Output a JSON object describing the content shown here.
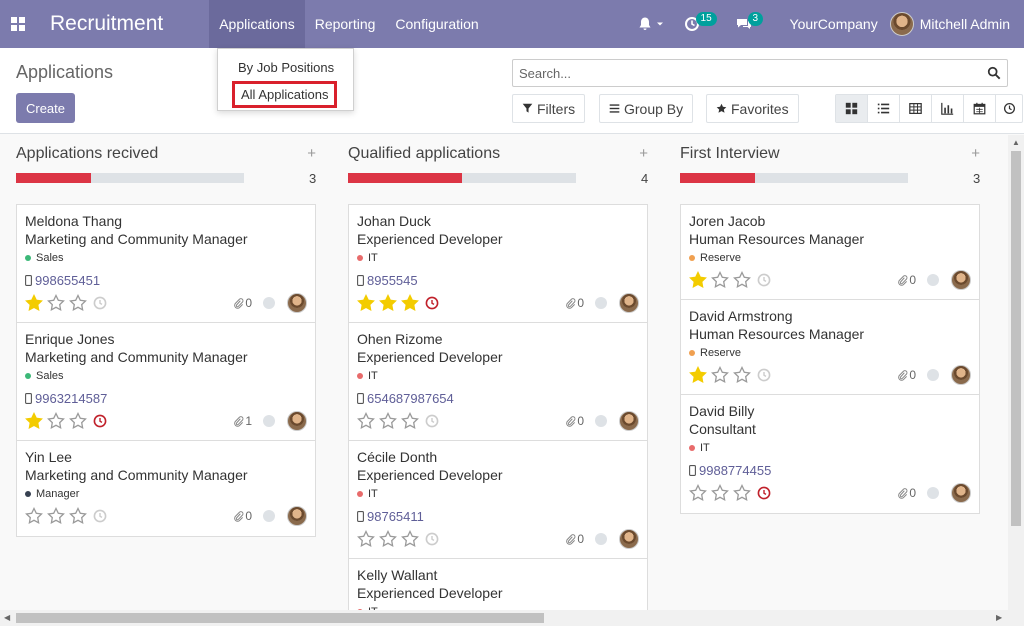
{
  "navbar": {
    "app_name": "Recruitment",
    "menu": [
      "Applications",
      "Reporting",
      "Configuration"
    ],
    "activity_count": "15",
    "message_count": "3",
    "company": "YourCompany",
    "user": "Mitchell Admin"
  },
  "dropdown": {
    "items": [
      "By Job Positions",
      "All Applications"
    ]
  },
  "control": {
    "breadcrumb": "Applications",
    "create_label": "Create",
    "search_placeholder": "Search...",
    "filters_label": "Filters",
    "group_by_label": "Group By",
    "favorites_label": "Favorites",
    "views": [
      "kanban-icon",
      "list-icon",
      "pivot-icon",
      "graph-icon",
      "calendar-icon",
      "activity-icon"
    ]
  },
  "columns": [
    {
      "title": "Applications recived",
      "count": "3",
      "progress": 0.33,
      "cards": [
        {
          "name": "Meldona Thang",
          "job": "Marketing and Community Manager",
          "tag": "Sales",
          "tag_color": "#3cb878",
          "phone": "998655451",
          "stars": 1,
          "activity": "none",
          "attachments": "0"
        },
        {
          "name": "Enrique Jones",
          "job": "Marketing and Community Manager",
          "tag": "Sales",
          "tag_color": "#3cb878",
          "phone": "9963214587",
          "stars": 1,
          "activity": "overdue",
          "attachments": "1"
        },
        {
          "name": "Yin Lee",
          "job": "Marketing and Community Manager",
          "tag": "Manager",
          "tag_color": "#374151",
          "phone": "",
          "stars": 0,
          "activity": "none",
          "attachments": "0"
        }
      ]
    },
    {
      "title": "Qualified applications",
      "count": "4",
      "progress": 0.5,
      "cards": [
        {
          "name": "Johan Duck",
          "job": "Experienced Developer",
          "tag": "IT",
          "tag_color": "#e86b6b",
          "phone": "8955545",
          "stars": 3,
          "activity": "overdue",
          "attachments": "0"
        },
        {
          "name": "Ohen Rizome",
          "job": "Experienced Developer",
          "tag": "IT",
          "tag_color": "#e86b6b",
          "phone": "654687987654",
          "stars": 0,
          "activity": "none",
          "attachments": "0"
        },
        {
          "name": "Cécile Donth",
          "job": "Experienced Developer",
          "tag": "IT",
          "tag_color": "#e86b6b",
          "phone": "98765411",
          "stars": 0,
          "activity": "none",
          "attachments": "0"
        },
        {
          "name": "Kelly Wallant",
          "job": "Experienced Developer",
          "tag": "IT",
          "tag_color": "#e86b6b",
          "phone": "",
          "stars": 0,
          "activity": "none",
          "attachments": "0"
        }
      ]
    },
    {
      "title": "First Interview",
      "count": "3",
      "progress": 0.33,
      "cards": [
        {
          "name": "Joren Jacob",
          "job": "Human Resources Manager",
          "tag": "Reserve",
          "tag_color": "#f0a050",
          "phone": "",
          "stars": 1,
          "activity": "none",
          "attachments": "0"
        },
        {
          "name": "David Armstrong",
          "job": "Human Resources Manager",
          "tag": "Reserve",
          "tag_color": "#f0a050",
          "phone": "",
          "stars": 1,
          "activity": "none",
          "attachments": "0"
        },
        {
          "name": "David Billy",
          "job": "Consultant",
          "tag": "IT",
          "tag_color": "#e86b6b",
          "phone": "9988774455",
          "stars": 0,
          "activity": "overdue",
          "attachments": "0"
        }
      ]
    }
  ]
}
